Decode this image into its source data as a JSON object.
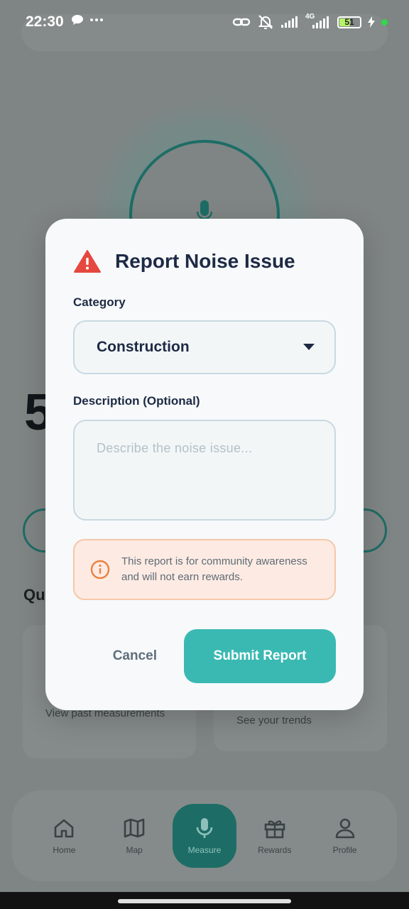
{
  "status_bar": {
    "time": "22:30",
    "battery": "51",
    "network": "4G"
  },
  "background": {
    "big_number": "5",
    "section_title": "Qu",
    "card_left_sub": "View past measurements",
    "card_right_sub": "See your trends"
  },
  "bottom_nav": {
    "items": [
      {
        "label": "Home",
        "icon": "home-icon"
      },
      {
        "label": "Map",
        "icon": "map-icon"
      },
      {
        "label": "Measure",
        "icon": "mic-icon"
      },
      {
        "label": "Rewards",
        "icon": "gift-icon"
      },
      {
        "label": "Profile",
        "icon": "person-icon"
      }
    ],
    "active": "Measure"
  },
  "dialog": {
    "title": "Report Noise Issue",
    "category_label": "Category",
    "category_value": "Construction",
    "description_label": "Description (Optional)",
    "description_placeholder": "Describe the noise issue...",
    "notice": "This report is for community awareness and will not earn rewards.",
    "cancel_label": "Cancel",
    "submit_label": "Submit Report"
  },
  "colors": {
    "accent": "#3ab9b3",
    "title": "#1d2a44",
    "warning_red": "#e5483e",
    "notice_orange": "#e8823f",
    "notice_bg": "#fdebe3"
  }
}
